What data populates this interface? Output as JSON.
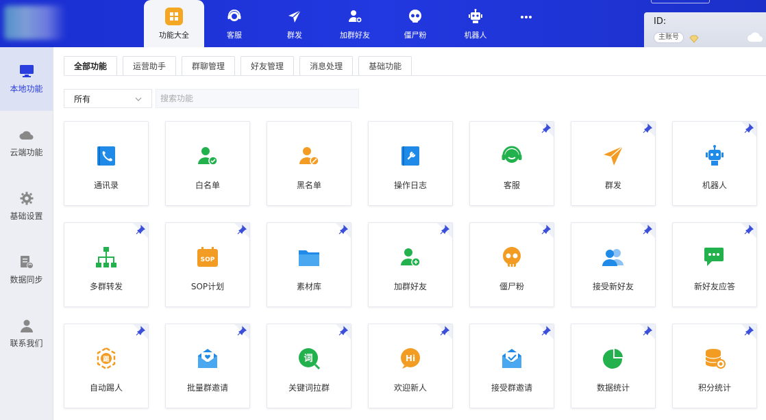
{
  "top_nav": {
    "tabs": [
      {
        "label": "功能大全",
        "icon": "grid-icon",
        "active": true
      },
      {
        "label": "客服",
        "icon": "headset-icon",
        "active": false
      },
      {
        "label": "群发",
        "icon": "send-icon",
        "active": false
      },
      {
        "label": "加群好友",
        "icon": "add-user-icon",
        "active": false
      },
      {
        "label": "僵尸粉",
        "icon": "skull-icon",
        "active": false
      },
      {
        "label": "机器人",
        "icon": "robot-icon",
        "active": false
      }
    ],
    "more_icon": "more-icon"
  },
  "user": {
    "id_label": "ID:",
    "account_badge": "主账号"
  },
  "sidebar": {
    "items": [
      {
        "label": "本地功能",
        "icon": "monitor-icon",
        "active": true
      },
      {
        "label": "云端功能",
        "icon": "cloud-icon",
        "active": false
      },
      {
        "label": "基础设置",
        "icon": "gear-icon",
        "active": false
      },
      {
        "label": "数据同步",
        "icon": "sync-icon",
        "active": false
      },
      {
        "label": "联系我们",
        "icon": "contact-icon",
        "active": false
      }
    ]
  },
  "main": {
    "tabs": [
      "全部功能",
      "运营助手",
      "群聊管理",
      "好友管理",
      "消息处理",
      "基础功能"
    ],
    "filter": {
      "selected": "所有"
    },
    "search": {
      "placeholder": "搜索功能",
      "value": ""
    },
    "cards": [
      {
        "label": "通讯录",
        "icon": "contacts-icon",
        "pinned": false
      },
      {
        "label": "白名单",
        "icon": "whitelist-icon",
        "pinned": false
      },
      {
        "label": "黑名单",
        "icon": "blacklist-icon",
        "pinned": false
      },
      {
        "label": "操作日志",
        "icon": "log-icon",
        "pinned": false
      },
      {
        "label": "客服",
        "icon": "headset-icon",
        "pinned": true
      },
      {
        "label": "群发",
        "icon": "send-icon",
        "pinned": true
      },
      {
        "label": "机器人",
        "icon": "robot-icon",
        "pinned": true
      },
      {
        "label": "多群转发",
        "icon": "org-chart-icon",
        "pinned": true
      },
      {
        "label": "SOP计划",
        "icon": "sop-icon",
        "pinned": true
      },
      {
        "label": "素材库",
        "icon": "folder-icon",
        "pinned": true
      },
      {
        "label": "加群好友",
        "icon": "add-user-icon",
        "pinned": true
      },
      {
        "label": "僵尸粉",
        "icon": "skull-icon",
        "pinned": true
      },
      {
        "label": "接受新好友",
        "icon": "users-icon",
        "pinned": true
      },
      {
        "label": "新好友应答",
        "icon": "chat-icon",
        "pinned": true
      },
      {
        "label": "自动踢人",
        "icon": "kick-icon",
        "pinned": true
      },
      {
        "label": "批量群邀请",
        "icon": "mail-heart-icon",
        "pinned": true
      },
      {
        "label": "关键词拉群",
        "icon": "keyword-icon",
        "pinned": true
      },
      {
        "label": "欢迎新人",
        "icon": "hi-icon",
        "pinned": true
      },
      {
        "label": "接受群邀请",
        "icon": "mail-check-icon",
        "pinned": true
      },
      {
        "label": "数据统计",
        "icon": "pie-chart-icon",
        "pinned": true
      },
      {
        "label": "积分统计",
        "icon": "coins-icon",
        "pinned": true
      }
    ]
  },
  "colors": {
    "brand_blue": "#2238e0",
    "accent_orange": "#f5a623",
    "green": "#23b14d",
    "blue_icon": "#1f8ae8"
  }
}
